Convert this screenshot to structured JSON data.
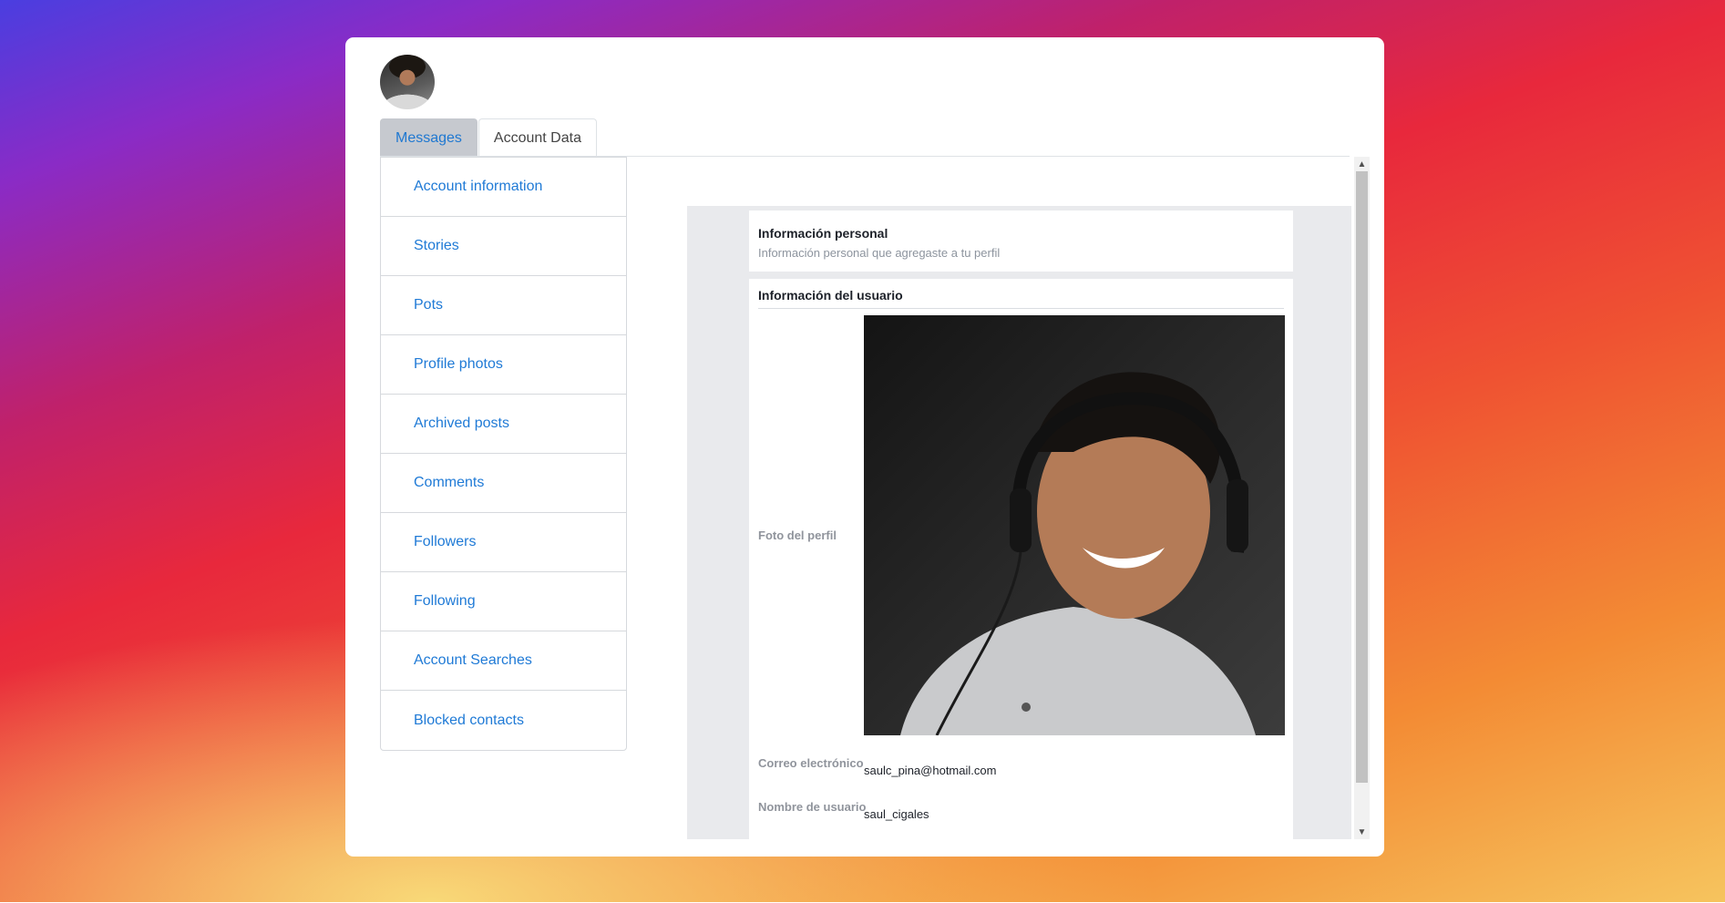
{
  "tabs": [
    {
      "label": "Messages",
      "active": true
    },
    {
      "label": "Account Data",
      "active": false
    }
  ],
  "menu": [
    {
      "label": "Account information"
    },
    {
      "label": "Stories"
    },
    {
      "label": "Pots"
    },
    {
      "label": "Profile photos"
    },
    {
      "label": "Archived posts"
    },
    {
      "label": "Comments"
    },
    {
      "label": "Followers"
    },
    {
      "label": "Following"
    },
    {
      "label": "Account Searches"
    },
    {
      "label": "Blocked contacts"
    }
  ],
  "personal": {
    "title": "Información personal",
    "subtitle": "Información personal que agregaste a tu perfil"
  },
  "user": {
    "title": "Información del usuario",
    "photo_label": "Foto del perfil",
    "email_label": "Correo electrónico",
    "email_value": "saulc_pina@hotmail.com",
    "username_label": "Nombre de usuario",
    "username_value": "saul_cigales"
  },
  "colors": {
    "link": "#1f7ad6",
    "active_tab_bg": "#c6c9cf",
    "panel_bg": "#e9eaed"
  },
  "icons": {
    "scroll_up": "scroll-up-arrow-icon",
    "scroll_down": "scroll-down-arrow-icon"
  }
}
